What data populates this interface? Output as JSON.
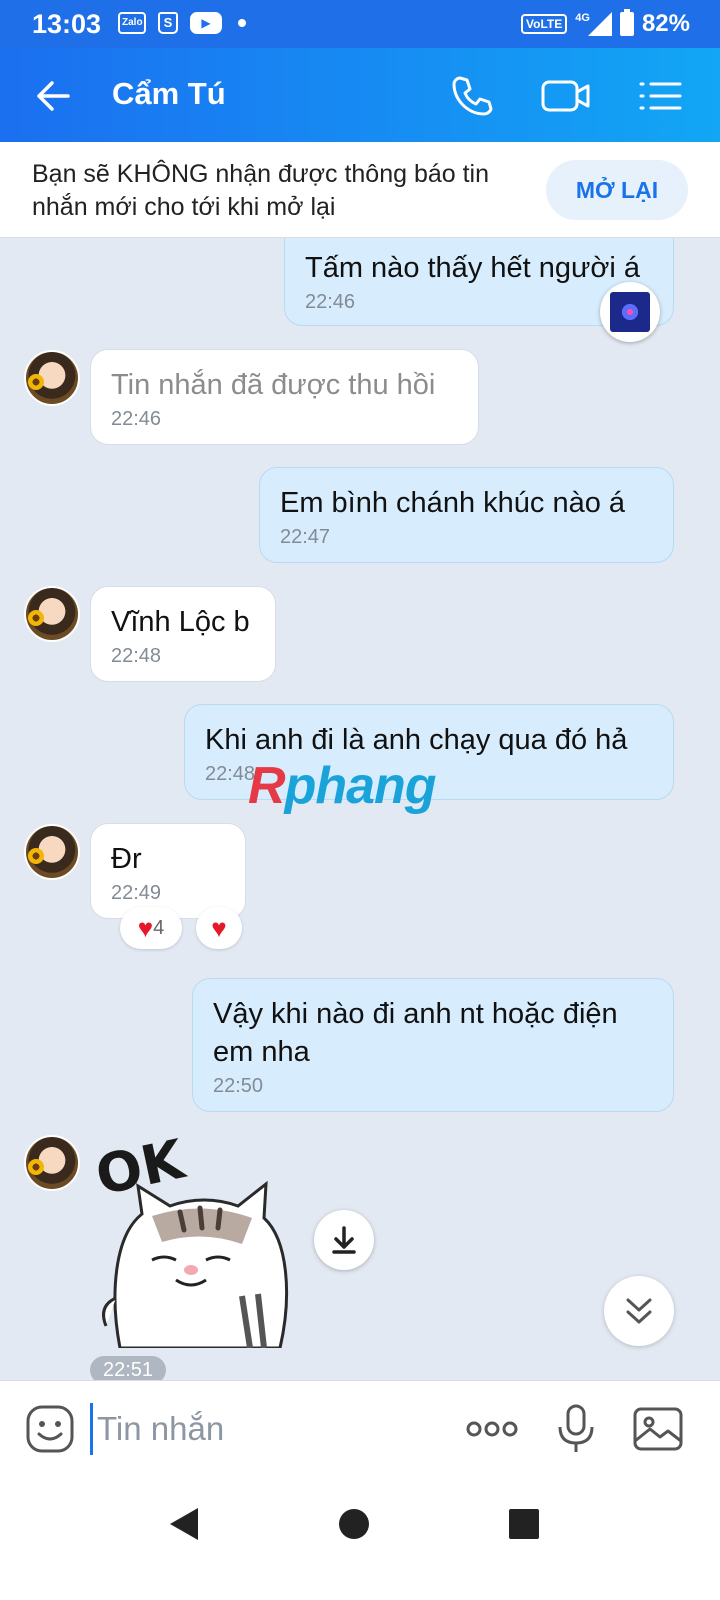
{
  "status_bar": {
    "time": "13:03",
    "notification_icons": [
      "zalo-icon",
      "shopee-icon",
      "youtube-icon",
      "dot-icon"
    ],
    "network": "VoLTE",
    "network_gen": "4G",
    "battery": "82%"
  },
  "header": {
    "contact_name": "Cẩm Tú",
    "icons": [
      "back-arrow-icon",
      "phone-icon",
      "video-call-icon",
      "list-menu-icon"
    ],
    "accent_color": "#1b6ff0"
  },
  "mute_banner": {
    "text": "Bạn sẽ KHÔNG nhận được thông báo tin nhắn mới cho tới khi mở lại",
    "button_label": "MỞ LẠI"
  },
  "messages": [
    {
      "side": "out",
      "text": "Tấm nào thấy hết người á",
      "time": "22:46",
      "reaction_icon": "firework-icon"
    },
    {
      "side": "in",
      "text": "Tin nhắn đã được thu hồi",
      "time": "22:46",
      "recalled": true
    },
    {
      "side": "out",
      "text": "Em bình chánh khúc nào á",
      "time": "22:47"
    },
    {
      "side": "in",
      "text": "Vĩnh Lộc b",
      "time": "22:48"
    },
    {
      "side": "out",
      "text": "Khi anh đi là anh chạy qua đó hả",
      "time": "22:48"
    },
    {
      "side": "in",
      "text": "Đr",
      "time": "22:49",
      "reaction_count": "4"
    },
    {
      "side": "out",
      "text": "Vậy khi nào đi anh nt hoặc điện em nha",
      "time": "22:50"
    },
    {
      "side": "in",
      "sticker": "cat-ok-sticker",
      "sticker_text": "OK",
      "time": "22:51"
    }
  ],
  "watermark": {
    "part1": "R",
    "part2": "phang"
  },
  "input_bar": {
    "placeholder": "Tin nhắn",
    "icons": [
      "emoji-icon",
      "more-options-icon",
      "microphone-icon",
      "image-icon"
    ]
  },
  "nav_bar": {
    "icons": [
      "back-nav-icon",
      "home-nav-icon",
      "recents-nav-icon"
    ]
  }
}
